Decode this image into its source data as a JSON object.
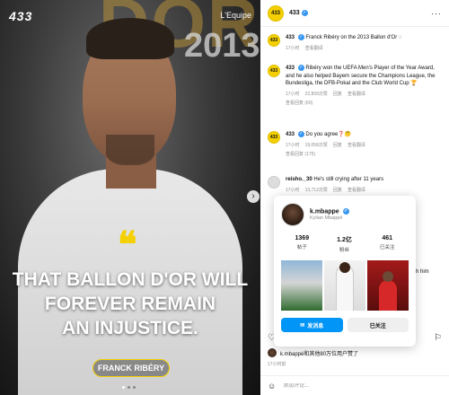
{
  "media": {
    "brand_logo": "433",
    "source": "L'Equipe",
    "bg_word": "DOR",
    "bg_year": "2013",
    "quote_mark": "❝",
    "headline_lines": [
      "THAT BALLON D'OR WILL",
      "FOREVER REMAIN",
      "AN INJUSTICE."
    ],
    "name_tag": "FRANCK RIBÉRY",
    "next_icon": "›",
    "carousel_count": 3
  },
  "header": {
    "avatar_text": "433",
    "account": "433",
    "more_icon": "···"
  },
  "caption": {
    "author": "433",
    "text": "Franck Ribéry on the 2013 Ballon d'Or ◌",
    "time": "17小时",
    "translate": "查看翻译"
  },
  "comments": [
    {
      "author": "433",
      "text": "Ribéry won the UEFA Men's Player of the Year Award, and he also helped Bayern secure the Champions League, the Bundesliga, the DFB-Pokal and the Club World Cup 🏆",
      "time": "17小时",
      "likes": "22,899次赞",
      "reply": "回复",
      "translate": "查看翻译",
      "replies": "查看回复 (60)"
    },
    {
      "author": "433",
      "text": "Do you agree❓🤔",
      "time": "17小时",
      "likes": "19,058次赞",
      "reply": "回复",
      "translate": "查看翻译",
      "replies": "查看回复 (175)"
    },
    {
      "author": "reisho._30",
      "text": "He's still crying after 11 years",
      "time": "17小时",
      "likes": "13,712次赞",
      "reply": "回复",
      "translate": "查看翻译"
    }
  ],
  "clipped_text": "ch him",
  "hovercard": {
    "username": "k.mbappe",
    "full_name": "Kylian Mbappé",
    "stats": [
      {
        "value": "1369",
        "label": "帖子"
      },
      {
        "value": "1.2亿",
        "label": "粉丝"
      },
      {
        "value": "461",
        "label": "已关注"
      }
    ],
    "message_button": "发消息",
    "following_button": "已关注",
    "message_icon": "✉"
  },
  "actions": {
    "like_icon": "♡",
    "comment_icon": "◯",
    "share_icon": "➤",
    "bookmark_icon": "⚐"
  },
  "liked_by": "k.mbappé和其他80万位用户赞了",
  "timestamp": "17小时前",
  "comment_box": {
    "placeholder": "添加评论...",
    "emoji_icon": "☺"
  }
}
